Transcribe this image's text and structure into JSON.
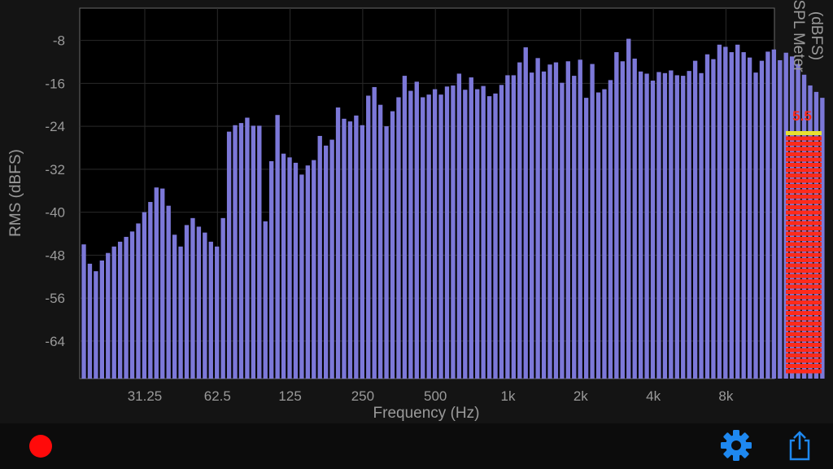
{
  "colors": {
    "background": "#141414",
    "plot_background": "#000000",
    "bar": "#7c78d8",
    "meter_red": "#ff2a1a",
    "meter_yellow": "#e8e030",
    "accent_blue": "#1e88f0",
    "record": "#ff0a0a"
  },
  "chart_data": {
    "type": "bar",
    "title": "",
    "xlabel": "Frequency (Hz)",
    "ylabel": "RMS (dBFS)",
    "y_ticks": [
      -8,
      -16,
      -24,
      -32,
      -40,
      -48,
      -56,
      -64
    ],
    "ylim": [
      -71,
      -2
    ],
    "x_scale": "log2",
    "x_ticks": [
      "31.25",
      "62.5",
      "125",
      "250",
      "500",
      "1k",
      "2k",
      "4k",
      "8k"
    ],
    "bands_per_octave": 12,
    "grid": true,
    "values": [
      -46,
      -49.6,
      -51,
      -49,
      -47.6,
      -46.4,
      -45.5,
      -44.6,
      -43.6,
      -42.1,
      -40,
      -38.1,
      -35.4,
      -35.6,
      -38.8,
      -44.2,
      -46.4,
      -42.4,
      -41.1,
      -42.7,
      -43.8,
      -45.5,
      -46.4,
      -41.1,
      -25,
      -23.8,
      -23.4,
      -22.4,
      -23.9,
      -23.9,
      -41.7,
      -30.5,
      -21.9,
      -29.1,
      -29.8,
      -30.8,
      -33,
      -31.3,
      -30.3,
      -25.8,
      -27.6,
      -26.5,
      -20.5,
      -22.6,
      -23.1,
      -22,
      -23.8,
      -18.3,
      -16.7,
      -20,
      -24,
      -21.2,
      -18.6,
      -14.6,
      -17.4,
      -15.7,
      -18.6,
      -18.1,
      -17.1,
      -18.1,
      -16.6,
      -16.4,
      -14.2,
      -17.2,
      -14.9,
      -17.1,
      -16.5,
      -18.4,
      -17.9,
      -16.3,
      -14.5,
      -14.5,
      -12.1,
      -9.3,
      -14,
      -11.3,
      -13.8,
      -12.5,
      -12.1,
      -15.9,
      -11.9,
      -14.6,
      -11.6,
      -18.7,
      -12.4,
      -17.7,
      -17.1,
      -15.4,
      -10.2,
      -11.9,
      -7.7,
      -11.4,
      -13.8,
      -14.2,
      -15.5,
      -13.9,
      -14.1,
      -13.6,
      -14.5,
      -14.6,
      -13.7,
      -11.8,
      -14.1,
      -10.6,
      -11.5,
      -8.8,
      -9.2,
      -10.2,
      -8.8,
      -10.2,
      -11.2,
      -14,
      -11.8,
      -10.1,
      -9.7,
      -11.7,
      -10.3,
      -11,
      -12.4,
      -14.4,
      -16.4,
      -17.6,
      -18.7
    ],
    "spl_meter": {
      "title": "SPL Meter",
      "unit": "(dBFS)",
      "value": "5.5",
      "level_fraction": 0.985
    }
  },
  "toolbar": {
    "record_icon": "record-icon",
    "settings_icon": "gear-icon",
    "share_icon": "share-icon"
  }
}
